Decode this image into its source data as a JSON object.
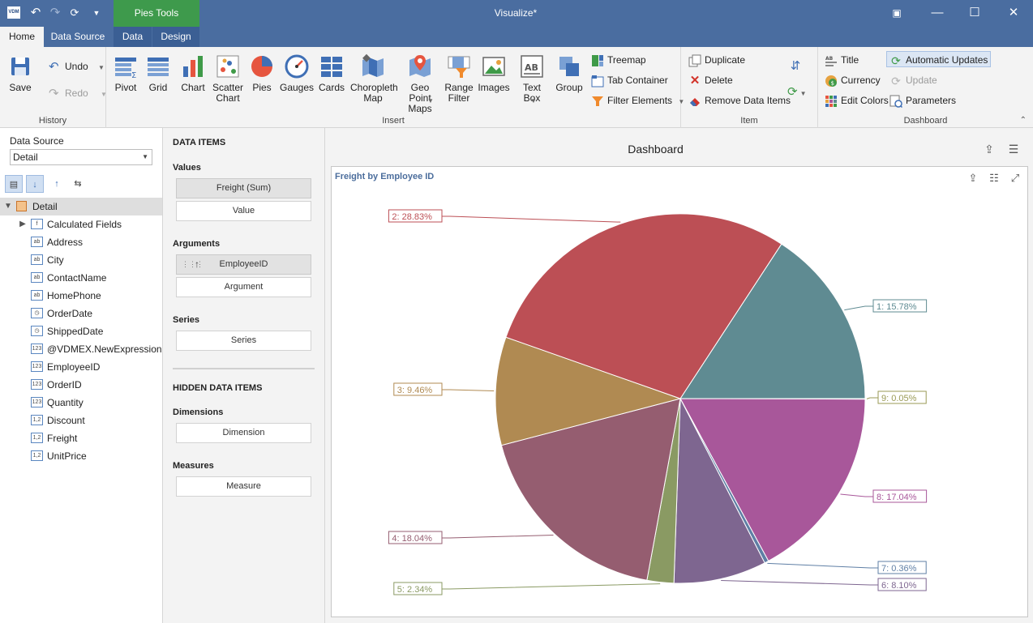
{
  "app": {
    "title": "Visualize*",
    "logo_text": "VDM",
    "context_tab": "Pies Tools"
  },
  "tabs": [
    "Home",
    "Data Source",
    "Data",
    "Design"
  ],
  "ribbon": {
    "history": {
      "label": "History",
      "save": "Save",
      "undo": "Undo",
      "redo": "Redo"
    },
    "insert": {
      "label": "Insert",
      "buttons": [
        "Pivot",
        "Grid",
        "Chart",
        "Scatter Chart",
        "Pies",
        "Gauges",
        "Cards",
        "Choropleth Map",
        "Geo Point Maps",
        "Range Filter",
        "Images",
        "Text Box",
        "Group"
      ],
      "small": [
        "Treemap",
        "Tab Container",
        "Filter Elements"
      ]
    },
    "item": {
      "label": "Item",
      "duplicate": "Duplicate",
      "delete": "Delete",
      "remove": "Remove Data Items"
    },
    "dashboard": {
      "label": "Dashboard",
      "title": "Title",
      "currency": "Currency",
      "edit_colors": "Edit Colors",
      "auto_updates": "Automatic Updates",
      "update": "Update",
      "parameters": "Parameters"
    }
  },
  "left": {
    "data_source_label": "Data Source",
    "data_source_value": "Detail",
    "root": "Detail",
    "fields": [
      {
        "name": "Calculated Fields",
        "type": "f"
      },
      {
        "name": "Address",
        "type": "ab"
      },
      {
        "name": "City",
        "type": "ab"
      },
      {
        "name": "ContactName",
        "type": "ab"
      },
      {
        "name": "HomePhone",
        "type": "ab"
      },
      {
        "name": "OrderDate",
        "type": "clock"
      },
      {
        "name": "ShippedDate",
        "type": "clock"
      },
      {
        "name": "@VDMEX.NewExpression",
        "type": "123"
      },
      {
        "name": "EmployeeID",
        "type": "123"
      },
      {
        "name": "OrderID",
        "type": "123"
      },
      {
        "name": "Quantity",
        "type": "123"
      },
      {
        "name": "Discount",
        "type": "1.2"
      },
      {
        "name": "Freight",
        "type": "1.2"
      },
      {
        "name": "UnitPrice",
        "type": "1.2"
      }
    ]
  },
  "data_items": {
    "header": "DATA ITEMS",
    "values_label": "Values",
    "values_filled": "Freight (Sum)",
    "values_empty": "Value",
    "arguments_label": "Arguments",
    "arguments_filled": "EmployeeID",
    "arguments_empty": "Argument",
    "series_label": "Series",
    "series_empty": "Series",
    "hidden_header": "HIDDEN DATA ITEMS",
    "dimensions_label": "Dimensions",
    "dimensions_empty": "Dimension",
    "measures_label": "Measures",
    "measures_empty": "Measure"
  },
  "dashboard": {
    "title": "Dashboard",
    "item_caption": "Freight by Employee ID"
  },
  "chart_data": {
    "type": "pie",
    "title": "Freight by Employee ID",
    "slices": [
      {
        "label": "1: 15.78%",
        "value": 15.78,
        "color": "#5f8b92"
      },
      {
        "label": "9: 0.05%",
        "value": 0.05,
        "color": "#9a9a55"
      },
      {
        "label": "8: 17.04%",
        "value": 17.04,
        "color": "#a8579a"
      },
      {
        "label": "7: 0.36%",
        "value": 0.36,
        "color": "#5f7fa5"
      },
      {
        "label": "6: 8.10%",
        "value": 8.1,
        "color": "#7e6690"
      },
      {
        "label": "5: 2.34%",
        "value": 2.34,
        "color": "#8a9a63"
      },
      {
        "label": "4: 18.04%",
        "value": 18.04,
        "color": "#955d70"
      },
      {
        "label": "3: 9.46%",
        "value": 9.46,
        "color": "#b08a52"
      },
      {
        "label": "2: 28.83%",
        "value": 28.83,
        "color": "#bc4f55"
      }
    ]
  }
}
